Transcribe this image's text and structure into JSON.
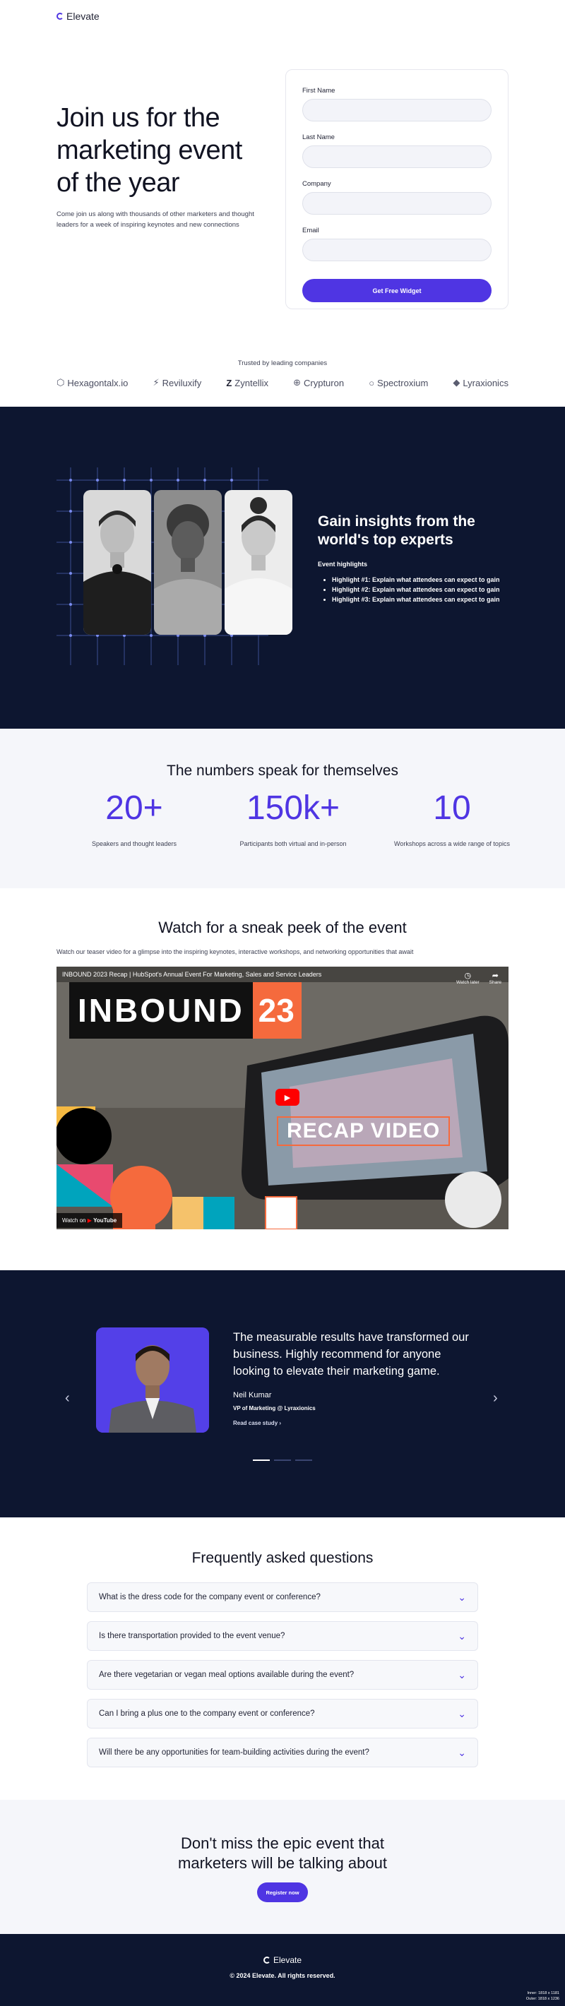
{
  "header": {
    "logo_text": "Elevate"
  },
  "hero": {
    "title": "Join us for the marketing event of the year",
    "subtitle": "Come join us along with thousands of other marketers and thought leaders for a week of inspiring keynotes and new connections"
  },
  "form": {
    "first_name_label": "First Name",
    "last_name_label": "Last Name",
    "company_label": "Company",
    "email_label": "Email",
    "submit_label": "Get Free Widget"
  },
  "trusted": {
    "title": "Trusted by leading companies",
    "logos": [
      "Hexagontalx.io",
      "Reviluxify",
      "Zyntellix",
      "Crypturon",
      "Spectroxium",
      "Lyraxionics"
    ]
  },
  "insights": {
    "title": "Gain insights from the world's top experts",
    "label": "Event highlights",
    "highlights": [
      "Highlight #1: Explain what attendees can expect to gain",
      "Highlight #2: Explain what attendees can expect to gain",
      "Highlight #3: Explain what attendees can expect to gain"
    ]
  },
  "stats": {
    "title": "The numbers speak for themselves",
    "items": [
      {
        "value": "20+",
        "label": "Speakers and thought leaders"
      },
      {
        "value": "150k+",
        "label": "Participants both virtual and in-person"
      },
      {
        "value": "10",
        "label": "Workshops across a wide range of topics"
      }
    ]
  },
  "video": {
    "title": "Watch for a sneak peek of the event",
    "subtitle": "Watch our teaser video for a glimpse into the inspiring keynotes, interactive workshops, and networking opportunities that await",
    "player_title": "INBOUND 2023 Recap | HubSpot's Annual Event For Marketing, Sales and Service Leaders",
    "badge_word": "INBOUND",
    "badge_number": "23",
    "recap_text": "RECAP VIDEO",
    "watch_later": "Watch later",
    "share": "Share",
    "watch_on": "Watch on",
    "youtube": "YouTube"
  },
  "testimonial": {
    "quote": "The measurable results have transformed our business. Highly recommend for anyone looking to elevate their marketing game.",
    "name": "Neil Kumar",
    "role": "VP of Marketing @ Lyraxionics",
    "link": "Read case study",
    "prev": "‹",
    "next": "›"
  },
  "faq": {
    "title": "Frequently asked questions",
    "items": [
      "What is the dress code for the company event or conference?",
      "Is there transportation provided to the event venue?",
      "Are there vegetarian or vegan meal options available during the event?",
      "Can I bring a plus one to the company event or conference?",
      "Will there be any opportunities for team-building activities during the event?"
    ]
  },
  "cta": {
    "title_line1": "Don't miss the epic event that",
    "title_line2": "marketers will be talking about",
    "button": "Register now"
  },
  "footer": {
    "logo_text": "Elevate",
    "copyright": "© 2024 Elevate. All rights reserved.",
    "dims_line1": "Inner: 1818 x 1181",
    "dims_line2": "Outer: 1818 x 1236"
  },
  "colors": {
    "accent": "#4f35e3",
    "navy": "#0d1630",
    "orange": "#f56a3d"
  }
}
